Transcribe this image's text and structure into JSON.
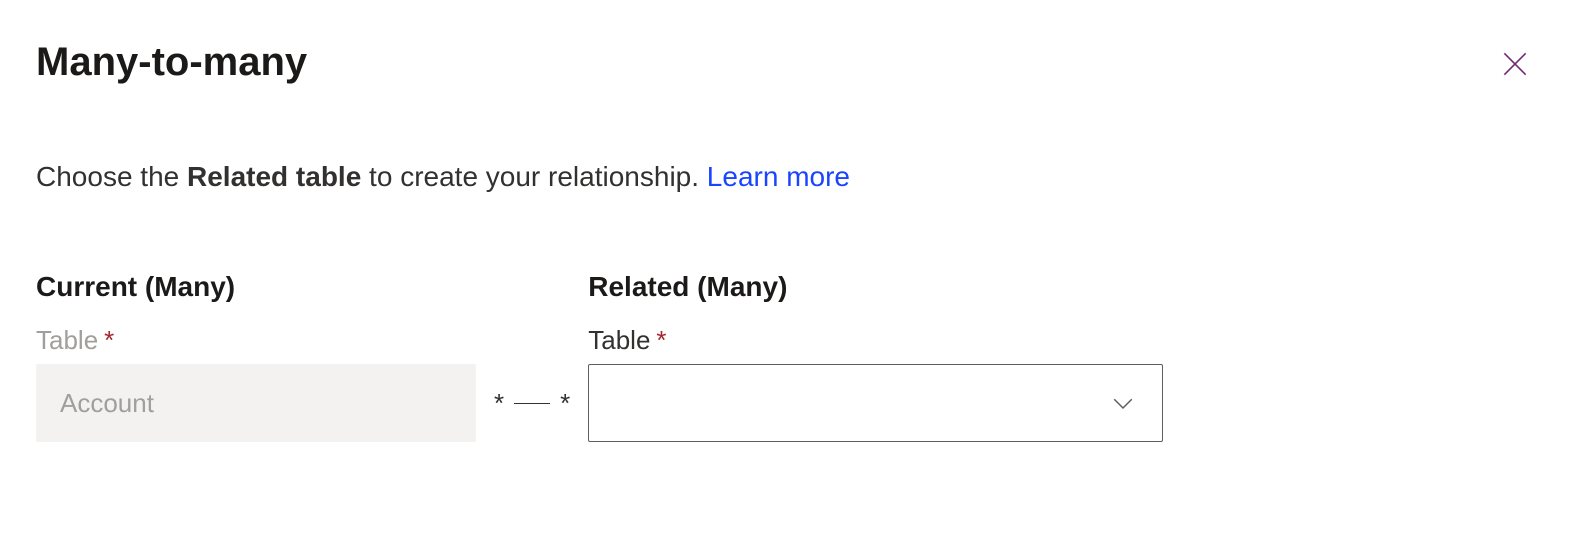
{
  "header": {
    "title": "Many-to-many"
  },
  "description": {
    "prefix": "Choose the ",
    "bold": "Related table",
    "suffix": " to create your relationship. ",
    "learn_more": "Learn more"
  },
  "current": {
    "header": "Current (Many)",
    "label": "Table",
    "required": "*",
    "value": "Account"
  },
  "connector": {
    "left_star": "*",
    "right_star": "*"
  },
  "related": {
    "header": "Related (Many)",
    "label": "Table",
    "required": "*",
    "value": ""
  }
}
